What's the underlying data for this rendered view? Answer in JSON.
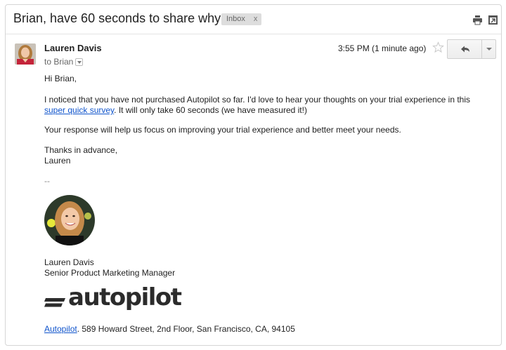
{
  "email": {
    "subject": "Brian, have 60 seconds to share why?",
    "label": "Inbox",
    "label_remove": "x",
    "sender": "Lauren Davis",
    "to": "to Brian",
    "timestamp": "3:55 PM (1 minute ago)",
    "icons": {
      "print": "print-icon",
      "popout": "new-window-icon",
      "star": "star-icon",
      "reply": "reply-arrow-icon",
      "more": "chevron-down-icon"
    }
  },
  "body": {
    "greeting": "Hi Brian,",
    "para1_before": "I noticed that you have not purchased Autopilot so far. I'd love to hear your thoughts on your trial experience in this ",
    "para1_link": "super quick survey",
    "para1_after": ". It will only take 60 seconds (we have measured it!)",
    "para2": "Your response will help us focus on improving your trial experience and better meet your needs.",
    "thanks": "Thanks in advance,",
    "signoff": "Lauren",
    "sig_separator": "--"
  },
  "signature": {
    "name": "Lauren Davis",
    "title": "Senior Product Marketing Manager",
    "logo_text": "autopilot",
    "logo_tm": "™",
    "address_link": "Autopilot",
    "address_rest": ". 589 Howard Street, 2nd Floor, San Francisco, CA, 94105"
  },
  "colors": {
    "link": "#1155cc",
    "label_bg": "#dddddd",
    "logo": "#2b2b2b"
  }
}
